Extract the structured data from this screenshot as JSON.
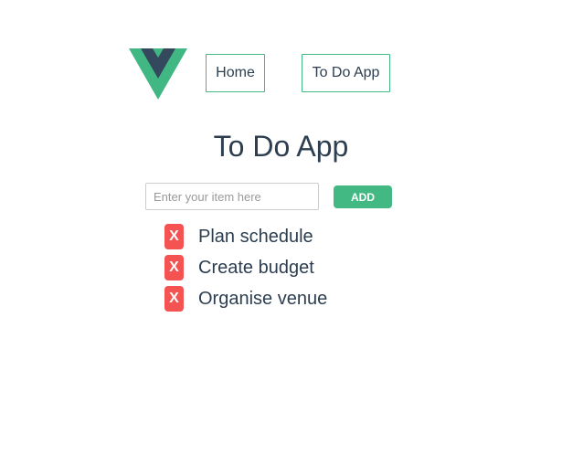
{
  "header": {
    "logo_icon": "vue-logo-icon",
    "nav": [
      {
        "label": "Home"
      },
      {
        "label": "To Do App"
      }
    ]
  },
  "main": {
    "title": "To Do App",
    "input": {
      "value": "",
      "placeholder": "Enter your item here"
    },
    "add_label": "ADD",
    "items": [
      {
        "remove_label": "X",
        "text": "Plan schedule"
      },
      {
        "remove_label": "X",
        "text": "Create budget"
      },
      {
        "remove_label": "X",
        "text": "Organise venue"
      }
    ]
  },
  "colors": {
    "accent": "#42b983",
    "danger": "#f55252",
    "text": "#2c3e50",
    "logo_dark": "#35495e"
  }
}
